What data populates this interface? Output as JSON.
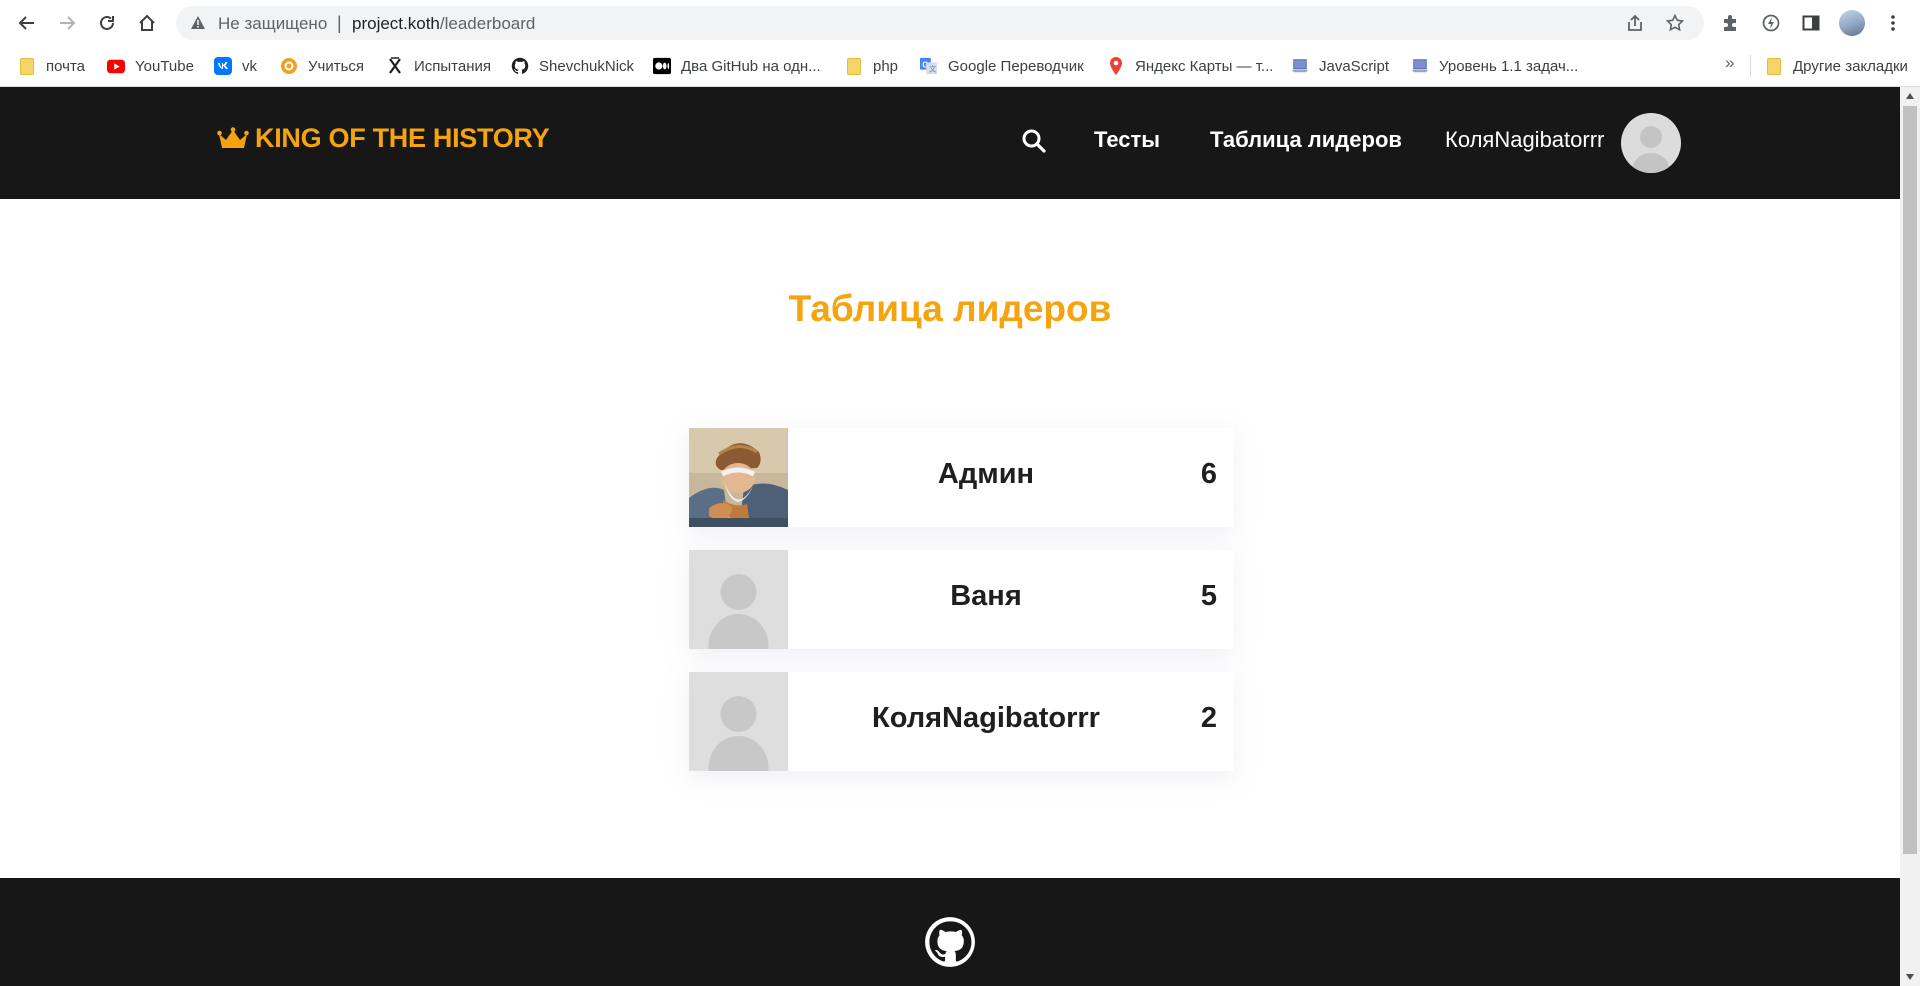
{
  "browser": {
    "security_label": "Не защищено",
    "url_host": "project.koth",
    "url_path": "/leaderboard",
    "bookmarks": [
      {
        "label": "почта",
        "icon": "folder-icon"
      },
      {
        "label": "YouTube",
        "icon": "youtube-icon"
      },
      {
        "label": "vk",
        "icon": "vk-icon"
      },
      {
        "label": "Учиться",
        "icon": "learn-icon"
      },
      {
        "label": "Испытания",
        "icon": "trials-icon"
      },
      {
        "label": "ShevchukNick",
        "icon": "github-icon"
      },
      {
        "label": "Два GitHub на одн...",
        "icon": "medium-icon"
      },
      {
        "label": "php",
        "icon": "folder-icon"
      },
      {
        "label": "Google Переводчик",
        "icon": "google-translate-icon"
      },
      {
        "label": "Яндекс Карты — т...",
        "icon": "map-pin-icon"
      },
      {
        "label": "JavaScript",
        "icon": "laptop-icon"
      },
      {
        "label": "Уровень 1.1 задач...",
        "icon": "laptop-icon"
      }
    ],
    "more_label": "»",
    "other_bookmarks": "Другие закладки"
  },
  "site": {
    "logo": "KING OF THE HISTORY",
    "nav": {
      "tests": "Тесты",
      "leaderboard": "Таблица лидеров"
    },
    "user_name": "КоляNagibatorrr",
    "accent_color": "#f5a410",
    "header_bg": "#171717"
  },
  "page": {
    "title": "Таблица лидеров",
    "leaders": [
      {
        "name": "Админ",
        "score": "6",
        "avatar": "portrait"
      },
      {
        "name": "Ваня",
        "score": "5",
        "avatar": "default-avatar"
      },
      {
        "name": "КоляNagibatorrr",
        "score": "2",
        "avatar": "default-avatar"
      }
    ]
  }
}
